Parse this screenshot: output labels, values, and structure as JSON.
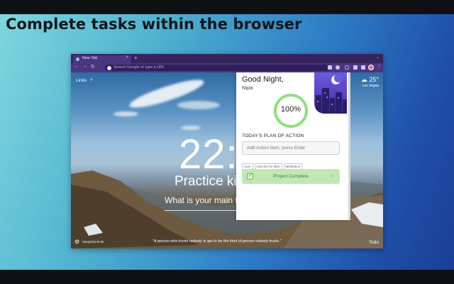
{
  "headline": "Complete tasks within the browser",
  "browser": {
    "tab_title": "New Tab",
    "tab_close": "×",
    "new_tab": "+",
    "window_chevron": "⌄",
    "back": "←",
    "forward": "→",
    "reload": "↻",
    "address_placeholder": "Search Google or type a URL"
  },
  "newtab": {
    "links_label": "Links",
    "search_icon": "⌕",
    "weather_icon": "☁",
    "temperature": "25°",
    "location": "Las Vegas",
    "clock": "22:2",
    "focus_text": "Practice ki",
    "main_question": "What is your main fo",
    "quote": "\"A person who trusts nobody is apt to be the kind of person nobody trusts.\"",
    "settings_icon": "⚙",
    "photo_credit": "Sangriela Bulla",
    "todo_label": "Todo"
  },
  "panel": {
    "greeting": "Good Night,",
    "name": "Nipa",
    "progress_text": "100%",
    "progress": 1.0,
    "plan_title": "TODAY'S PLAN OF ACTION",
    "add_placeholder": "Add Action Item, press Enter",
    "chips": [
      "Gym",
      "Link site for later",
      "Meditation"
    ],
    "complete_label": "Project Complete",
    "complete_check": "✓",
    "dismiss": "×"
  },
  "colors": {
    "accent_green": "#8ee07e",
    "complete_bg": "#bfe9b0",
    "browser_purple": "#4a3680",
    "moon_purple": "#6a5be0"
  }
}
